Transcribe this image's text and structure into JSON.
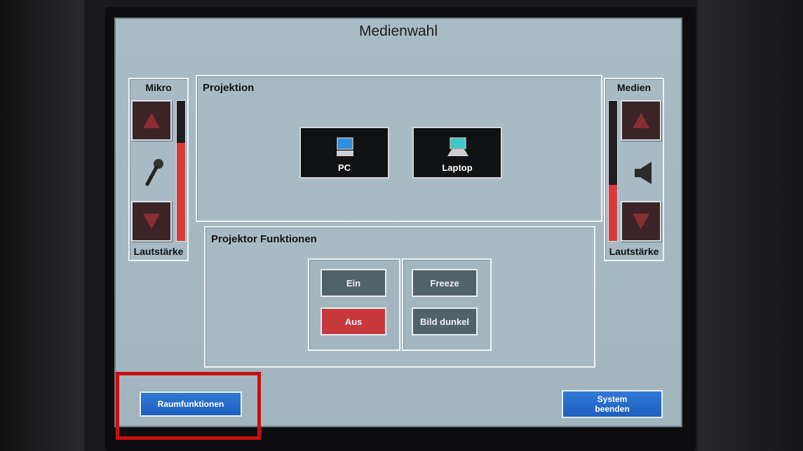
{
  "title": "Medienwahl",
  "left": {
    "header": "Mikro",
    "footer": "Lautstärke",
    "level": 0.7
  },
  "right": {
    "header": "Medien",
    "footer": "Lautstärke",
    "level": 0.4
  },
  "projection": {
    "label": "Projektion",
    "sources": [
      {
        "label": "PC",
        "icon": "desktop-pc-icon"
      },
      {
        "label": "Laptop",
        "icon": "laptop-icon"
      }
    ]
  },
  "projector": {
    "label": "Projektor Funktionen",
    "on": "Ein",
    "off": "Aus",
    "freeze": "Freeze",
    "blank": "Bild dunkel"
  },
  "footer": {
    "room_functions": "Raumfunktionen",
    "system_exit_line1": "System",
    "system_exit_line2": "beenden"
  },
  "colors": {
    "accent_blue": "#1e5fbf",
    "active_red": "#c8383a",
    "annotation_red": "#c80f0f"
  }
}
